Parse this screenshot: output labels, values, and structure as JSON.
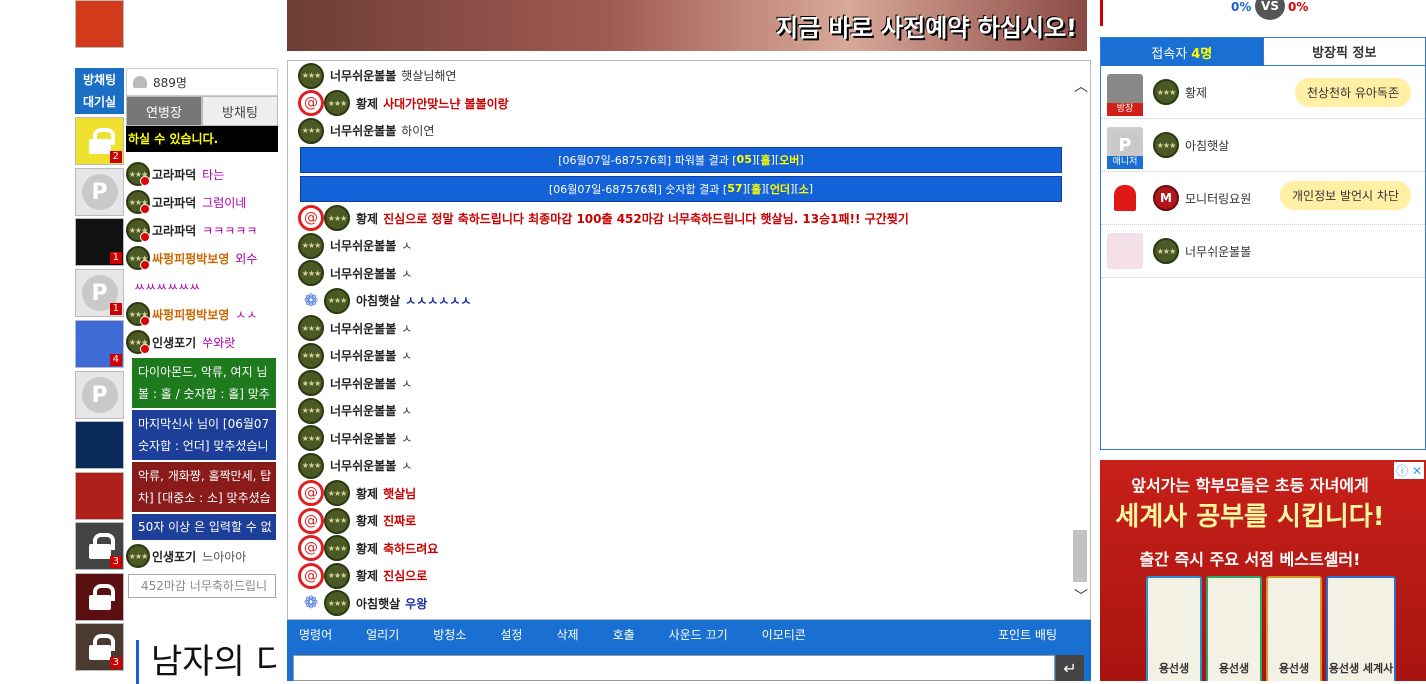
{
  "left_column": {
    "waitroom_label": "방채팅\n대기실",
    "thumbs": [
      {
        "count": "2",
        "lock": true
      },
      {
        "count": "",
        "lock": false
      },
      {
        "count": "1",
        "lock": false
      },
      {
        "count": "1",
        "lock": false
      },
      {
        "count": "4",
        "lock": false
      },
      {
        "count": "",
        "lock": false
      },
      {
        "count": "",
        "lock": false
      },
      {
        "count": "",
        "lock": false
      },
      {
        "count": "3",
        "lock": true
      },
      {
        "count": "",
        "lock": true
      },
      {
        "count": "3",
        "lock": true
      }
    ]
  },
  "left_chat": {
    "viewer_count": "889명",
    "tabs": [
      "연병장",
      "방채팅"
    ],
    "notice": "하실 수 있습니다.",
    "rows": [
      {
        "nick": "고라파덕",
        "msg": "타는"
      },
      {
        "nick": "고라파덕",
        "msg": "그럼이네"
      },
      {
        "nick": "고라파덕",
        "msg": "ㅋㅋㅋㅋㅋ"
      },
      {
        "nick": "싸펑피펑박보영",
        "msg": "외수"
      },
      {
        "nick": "",
        "msg": "ㅆㅆㅆㅆㅆㅆ"
      },
      {
        "nick": "싸펑피펑박보영",
        "msg": "ㅅㅅ"
      },
      {
        "nick": "인생포기",
        "msg": "쑤와랏"
      }
    ],
    "boxes": [
      {
        "line1": "다이아몬드, 악류, 여지 님",
        "line2": "볼 : 홀 / 숫자합 : 홀] 맞추"
      },
      {
        "line1": "마지막신사 님이 [06월07",
        "line2": "숫자합 : 언더] 맞추셨습니"
      },
      {
        "line1": "악류, 개화쨩, 홀짝만세, 탑",
        "line2": "차] [대중소 : 소] 맞추셨습"
      }
    ],
    "limit_notice": "50자 이상 은 입력할 수 없",
    "last_row": {
      "nick": "인생포기",
      "msg": "느아아아"
    },
    "input_placeholder": "452마감 너무축하드립니"
  },
  "big_title": "남자의 디",
  "banner": {
    "text": "지금 바로 사전예약 하십시오!"
  },
  "chat": {
    "rows": [
      {
        "type": "msg",
        "icon": "army",
        "nick": "너무쉬운볼볼",
        "msg": "햇살님해연",
        "style": ""
      },
      {
        "type": "msg",
        "icon": "spiral",
        "nick": "황제",
        "msg": "사대가안맞느냔 볼볼이랑",
        "style": "red"
      },
      {
        "type": "msg",
        "icon": "army",
        "nick": "너무쉬운볼볼",
        "msg": "하이연",
        "style": ""
      },
      {
        "type": "sys",
        "pre": "[06월07일-687576회] 파워볼 결과 [",
        "v1": "05",
        "mid1": "][",
        "v2": "홀",
        "mid2": "][",
        "v3": "오버",
        "post": "]"
      },
      {
        "type": "sys",
        "pre": "[06월07일-687576회] 숫자합 결과 [",
        "v1": "57",
        "mid1": "][",
        "v2": "홀",
        "mid2": "][",
        "v3": "언더",
        "mid3": "][",
        "v4": "소",
        "post": "]"
      },
      {
        "type": "msg",
        "icon": "spiral",
        "nick": "황제",
        "msg": "진심으로 정말 축하드립니다 최종마감 100출 452마감 너무축하드립니다 햇살님. 13승1패!! 구간찢기",
        "style": "red"
      },
      {
        "type": "msg",
        "icon": "army",
        "nick": "너무쉬운볼볼",
        "msg": "ㅅ",
        "style": ""
      },
      {
        "type": "msg",
        "icon": "army",
        "nick": "너무쉬운볼볼",
        "msg": "ㅅ",
        "style": ""
      },
      {
        "type": "msg",
        "icon": "flower",
        "nick": "아침햇살",
        "msg": "ㅅㅅㅅㅅㅅㅅ",
        "style": "navy"
      },
      {
        "type": "msg",
        "icon": "army",
        "nick": "너무쉬운볼볼",
        "msg": "ㅅ",
        "style": ""
      },
      {
        "type": "msg",
        "icon": "army",
        "nick": "너무쉬운볼볼",
        "msg": "ㅅ",
        "style": ""
      },
      {
        "type": "msg",
        "icon": "army",
        "nick": "너무쉬운볼볼",
        "msg": "ㅅ",
        "style": ""
      },
      {
        "type": "msg",
        "icon": "army",
        "nick": "너무쉬운볼볼",
        "msg": "ㅅ",
        "style": ""
      },
      {
        "type": "msg",
        "icon": "army",
        "nick": "너무쉬운볼볼",
        "msg": "ㅅ",
        "style": ""
      },
      {
        "type": "msg",
        "icon": "army",
        "nick": "너무쉬운볼볼",
        "msg": "ㅅ",
        "style": ""
      },
      {
        "type": "msg",
        "icon": "spiral",
        "nick": "황제",
        "msg": "햇살님",
        "style": "red"
      },
      {
        "type": "msg",
        "icon": "spiral",
        "nick": "황제",
        "msg": "진짜로",
        "style": "red"
      },
      {
        "type": "msg",
        "icon": "spiral",
        "nick": "황제",
        "msg": "축하드려요",
        "style": "red"
      },
      {
        "type": "msg",
        "icon": "spiral",
        "nick": "황제",
        "msg": "진심으로",
        "style": "red"
      },
      {
        "type": "msg",
        "icon": "flower",
        "nick": "아침햇살",
        "msg": "우왕",
        "style": "navy"
      }
    ]
  },
  "menu": {
    "items": [
      "명령어",
      "얼리기",
      "방청소",
      "설정",
      "삭제",
      "호출",
      "사운드 끄기",
      "이모티콘"
    ],
    "point_bet": "포인트 배팅"
  },
  "score": {
    "blue": "0%",
    "vs": "VS",
    "red": "0%"
  },
  "users_panel": {
    "tab_users_label": "접속자",
    "tab_users_count": "4명",
    "tab_info": "방장픽 정보",
    "users": [
      {
        "name": "황제",
        "tag": "방장",
        "tag_color": "#d0201a",
        "bubble": "천상천하 유아독존",
        "icon": "army"
      },
      {
        "name": "아침햇살",
        "tag": "매니저",
        "tag_color": "#1a6fd2",
        "bubble": "",
        "icon": "army"
      },
      {
        "name": "모니터링요원",
        "tag": "",
        "tag_color": "",
        "bubble": "개인정보 발언시 차단",
        "icon": "mon"
      },
      {
        "name": "너무쉬운볼볼",
        "tag": "",
        "tag_color": "",
        "bubble": "",
        "icon": "army"
      }
    ]
  },
  "ad": {
    "line1": "앞서가는 학부모들은 초등 자녀에게",
    "line2": "세계사 공부를 시킵니다!",
    "line3": "출간 즉시 주요 서점 베스트셀러!",
    "book_title": "용선생",
    "book_title_last": "용선생 세계사"
  }
}
